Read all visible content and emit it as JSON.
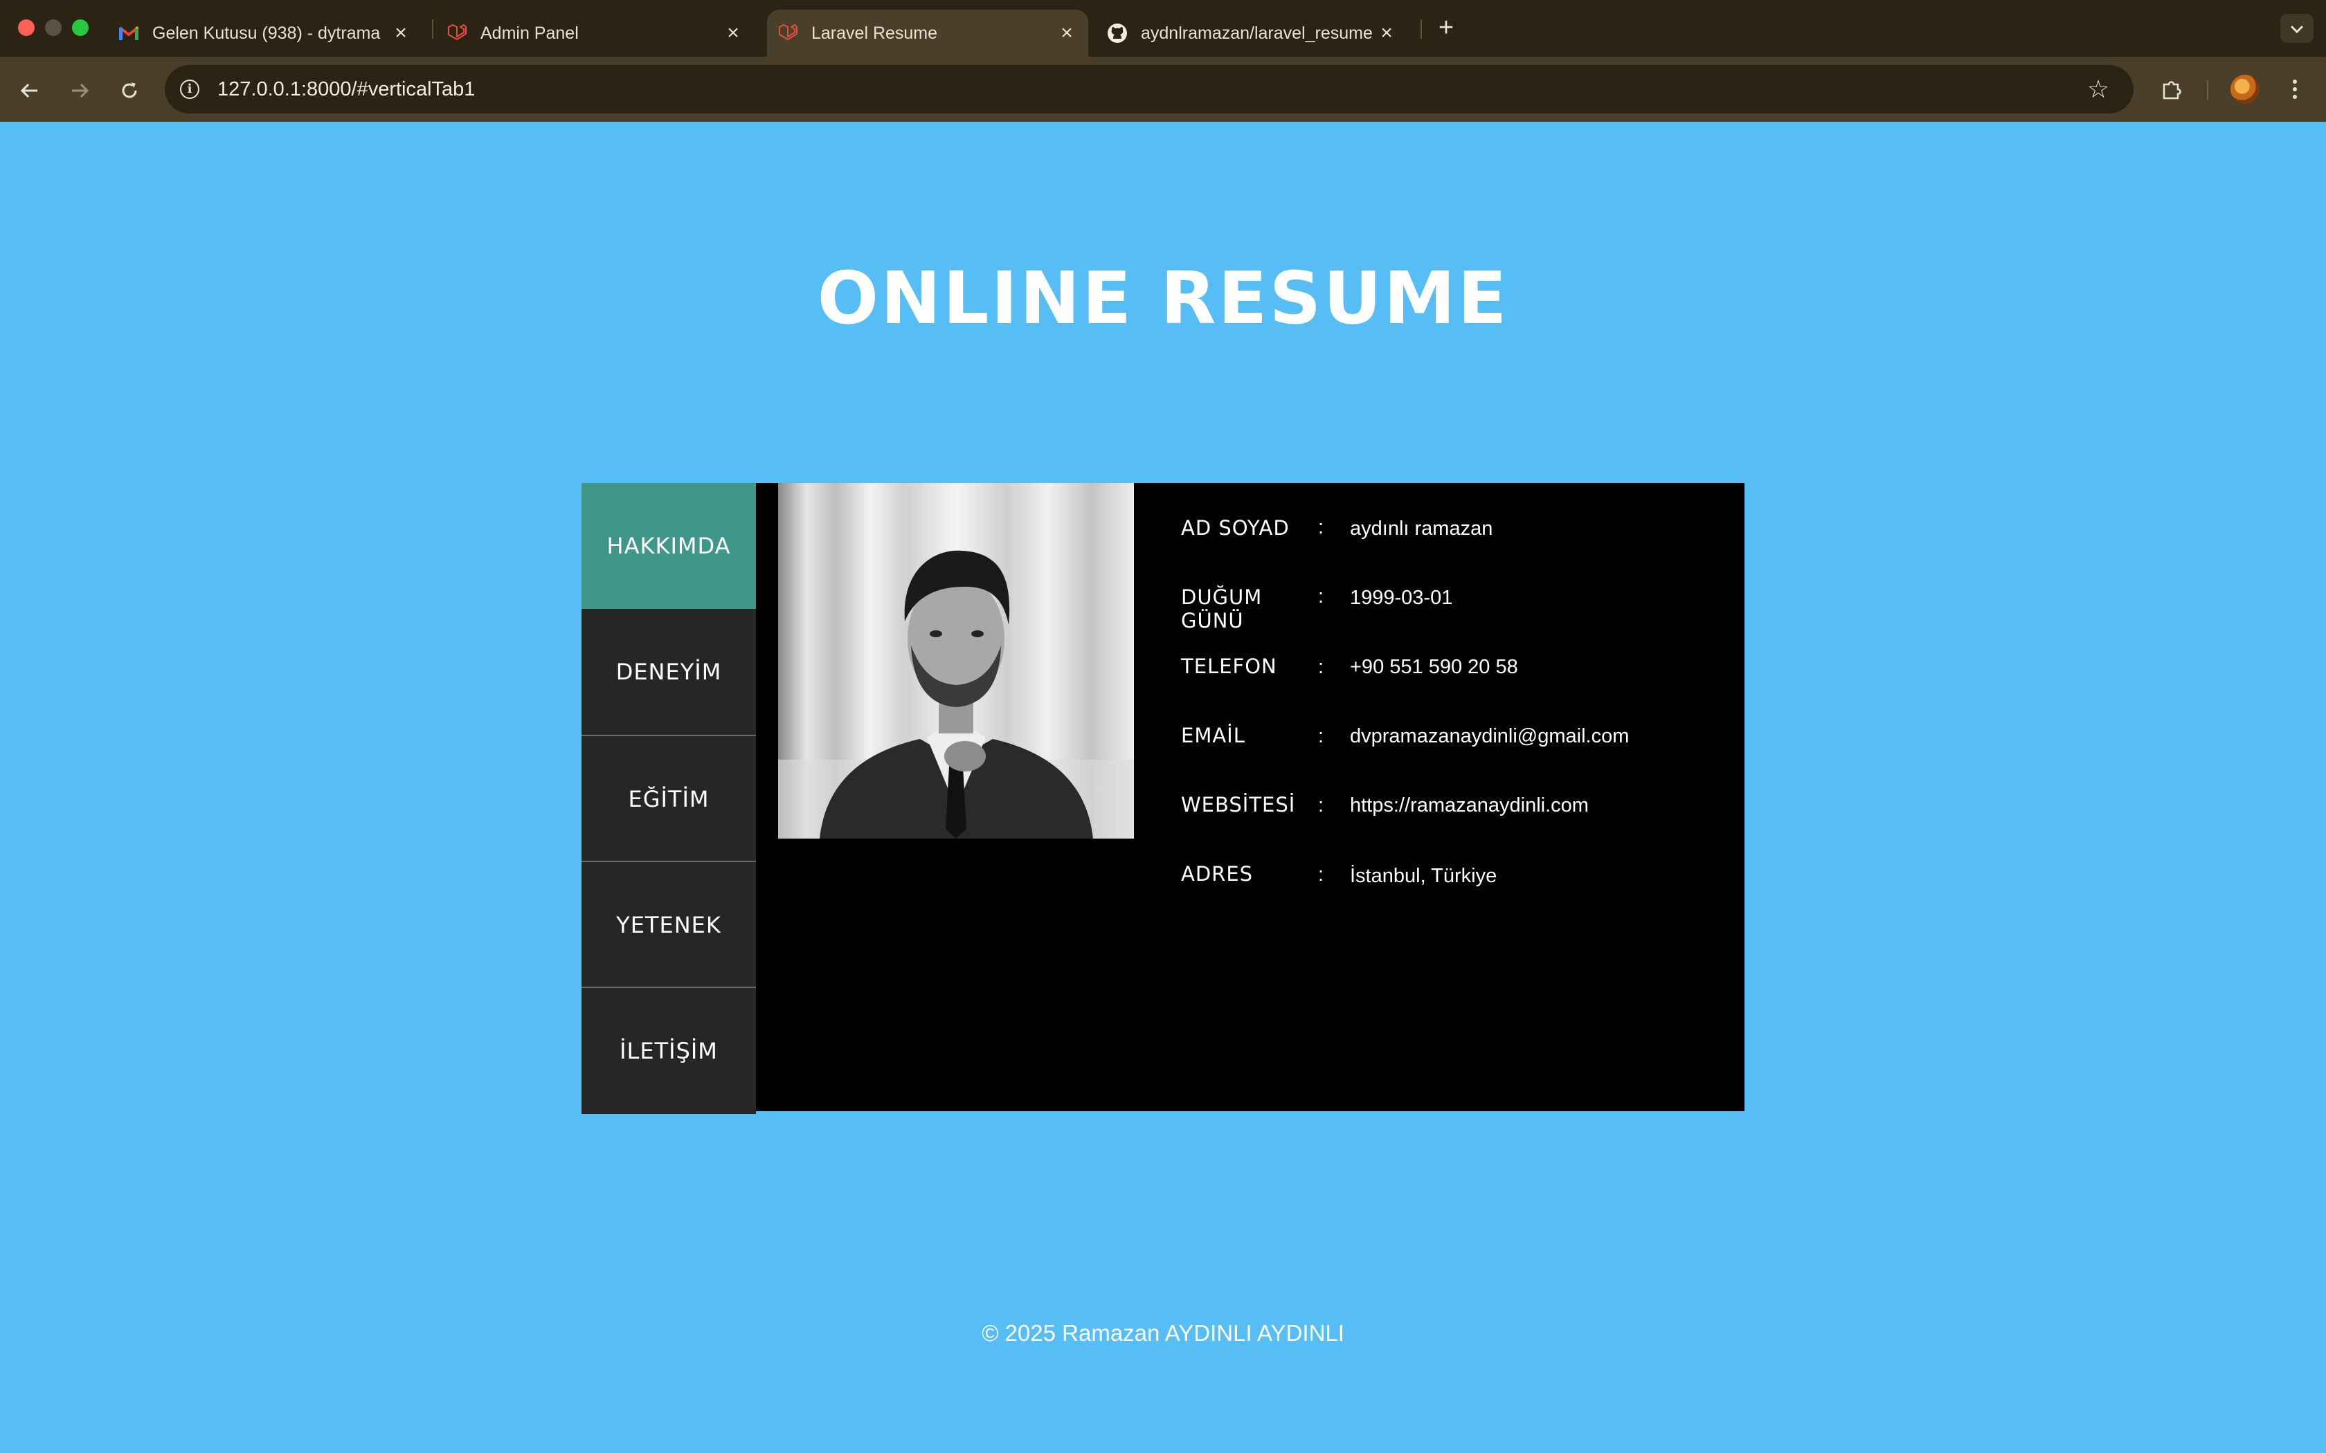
{
  "browser": {
    "tabs": [
      {
        "title": "Gelen Kutusu (938) - dytrama",
        "icon": "gmail-icon"
      },
      {
        "title": "Admin Panel",
        "icon": "laravel-icon"
      },
      {
        "title": "Laravel Resume",
        "icon": "laravel-icon",
        "active": true
      },
      {
        "title": "aydnlramazan/laravel_resume",
        "icon": "github-icon"
      }
    ],
    "close_glyph": "×",
    "new_tab_glyph": "+",
    "url": "127.0.0.1:8000/#verticalTab1"
  },
  "page": {
    "title": "ONLINE RESUME",
    "nav": [
      "HAKKIMDA",
      "DENEYİM",
      "EĞİTİM",
      "YETENEK",
      "İLETİŞİM"
    ],
    "active_nav": "HAKKIMDA",
    "about": [
      {
        "label": "AD SOYAD",
        "value": "aydınlı ramazan"
      },
      {
        "label": "DUĞUM GÜNÜ",
        "value": "1999-03-01"
      },
      {
        "label": "TELEFON",
        "value": "+90 551 590 20 58"
      },
      {
        "label": "EMAİL",
        "value": "dvpramazanaydinli@gmail.com"
      },
      {
        "label": "WEBSİTESİ",
        "value": "https://ramazanaydinli.com"
      },
      {
        "label": "ADRES",
        "value": "İstanbul, Türkiye"
      }
    ],
    "separator": ":",
    "footer": "© 2025 Ramazan AYDINLI AYDINLI"
  },
  "colors": {
    "page_bg": "#57bdf5",
    "active_tab": "#3f9789",
    "tab_bg": "#262626",
    "panel_bg": "#000000"
  }
}
